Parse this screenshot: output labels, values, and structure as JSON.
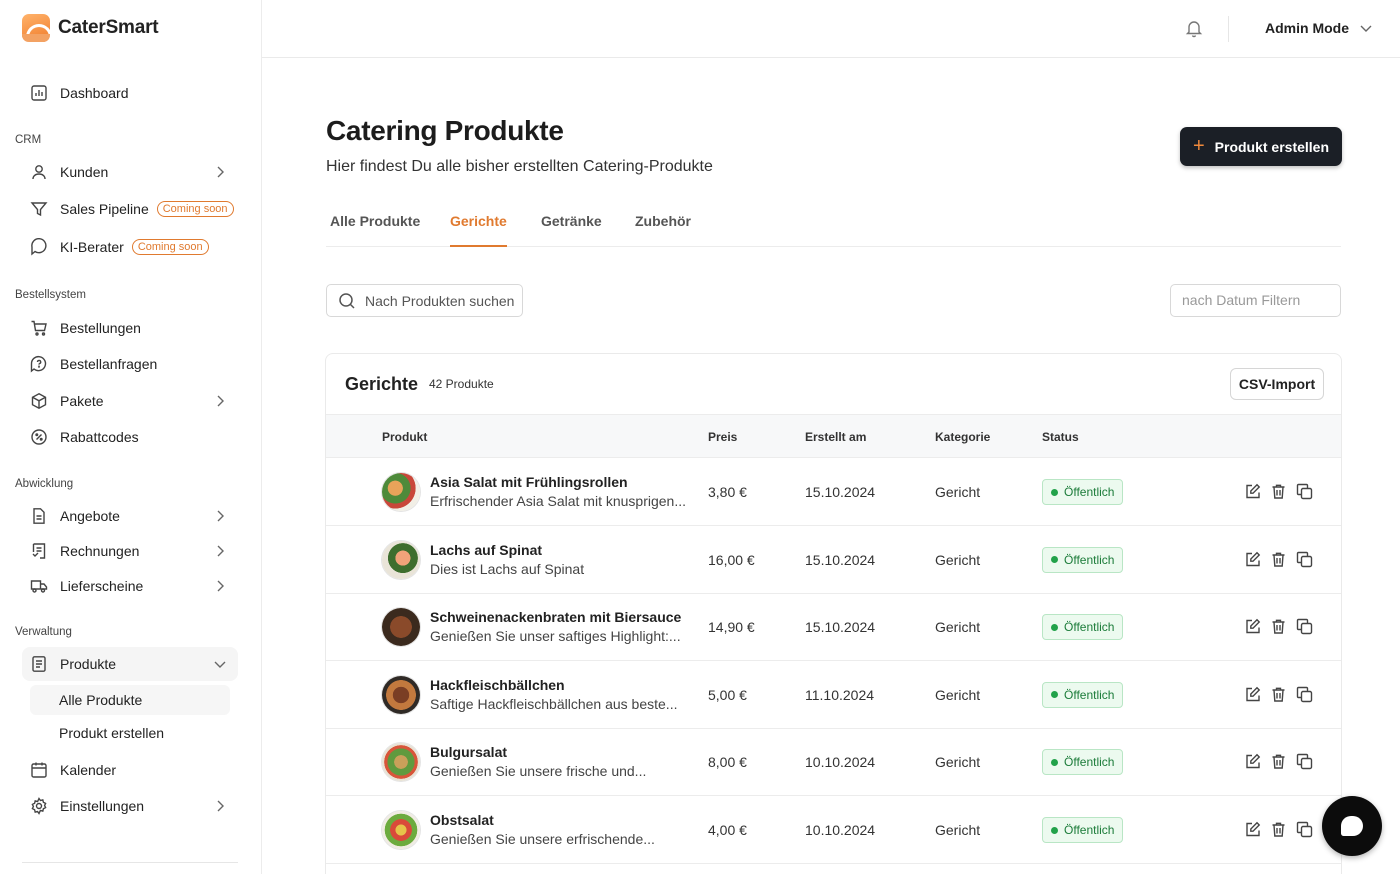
{
  "app": {
    "name": "CaterSmart"
  },
  "sidebar": {
    "dashboard": "Dashboard",
    "sections": {
      "crm": "CRM",
      "bestellsystem": "Bestellsystem",
      "abwicklung": "Abwicklung",
      "verwaltung": "Verwaltung"
    },
    "items": {
      "kunden": "Kunden",
      "sales_pipeline": "Sales Pipeline",
      "ki_berater": "KI-Berater",
      "coming_soon": "Coming soon",
      "bestellungen": "Bestellungen",
      "bestellanfragen": "Bestellanfragen",
      "pakete": "Pakete",
      "rabattcodes": "Rabattcodes",
      "angebote": "Angebote",
      "rechnungen": "Rechnungen",
      "lieferscheine": "Lieferscheine",
      "produkte": "Produkte",
      "alle_produkte": "Alle Produkte",
      "produkt_erstellen": "Produkt erstellen",
      "kalender": "Kalender",
      "einstellungen": "Einstellungen"
    }
  },
  "header": {
    "mode": "Admin Mode"
  },
  "main": {
    "title": "Catering Produkte",
    "subtitle": "Hier findest Du alle bisher erstellten Catering-Produkte",
    "create_button": "Produkt erstellen",
    "tabs": [
      "Alle Produkte",
      "Gerichte",
      "Getränke",
      "Zubehör"
    ],
    "active_tab": "Gerichte",
    "search_placeholder": "Nach Produkten suchen",
    "date_placeholder": "nach Datum Filtern"
  },
  "table": {
    "title": "Gerichte",
    "count": "42 Produkte",
    "csv_button": "CSV-Import",
    "columns": [
      "Produkt",
      "Preis",
      "Erstellt am",
      "Kategorie",
      "Status"
    ],
    "rows": [
      {
        "name": "Asia Salat mit Frühlingsrollen",
        "desc": "Erfrischender Asia Salat mit knusprigen...",
        "price": "3,80 €",
        "date": "15.10.2024",
        "category": "Gericht",
        "status": "Öffentlich"
      },
      {
        "name": "Lachs auf Spinat",
        "desc": "Dies ist Lachs auf Spinat",
        "price": "16,00 €",
        "date": "15.10.2024",
        "category": "Gericht",
        "status": "Öffentlich"
      },
      {
        "name": "Schweinenackenbraten mit Biersauce",
        "desc": "Genießen Sie unser saftiges Highlight:...",
        "price": "14,90 €",
        "date": "15.10.2024",
        "category": "Gericht",
        "status": "Öffentlich"
      },
      {
        "name": "Hackfleischbällchen",
        "desc": "Saftige Hackfleischbällchen aus beste...",
        "price": "5,00 €",
        "date": "11.10.2024",
        "category": "Gericht",
        "status": "Öffentlich"
      },
      {
        "name": "Bulgursalat",
        "desc": "Genießen Sie unsere frische und...",
        "price": "8,00 €",
        "date": "10.10.2024",
        "category": "Gericht",
        "status": "Öffentlich"
      },
      {
        "name": "Obstsalat",
        "desc": "Genießen Sie unsere erfrischende...",
        "price": "4,00 €",
        "date": "10.10.2024",
        "category": "Gericht",
        "status": "Öffentlich"
      }
    ]
  },
  "colors": {
    "accent": "#e07a2f",
    "primary_button": "#1b1f26",
    "status_green": "#22a24a"
  }
}
